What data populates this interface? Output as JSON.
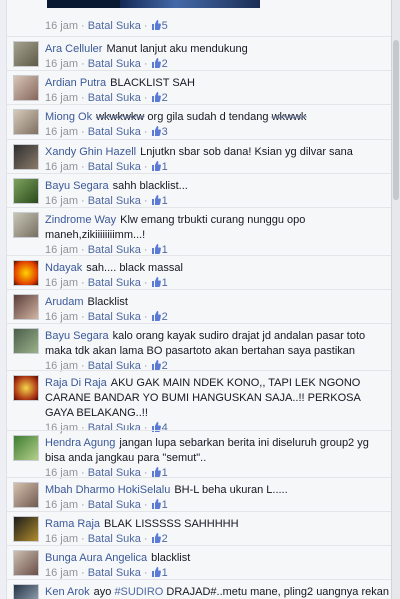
{
  "meta_labels": {
    "time": "16 jam",
    "sep": "·",
    "unlike": "Batal Suka"
  },
  "top_row": {
    "likes": "5"
  },
  "comments": [
    {
      "author": "Ara Celluler",
      "text": "Manut lanjut aku mendukung",
      "likes": "2"
    },
    {
      "author": "Ardian Putra",
      "text": "BLACKLIST SAH",
      "likes": "2"
    },
    {
      "author": "Miong Ok",
      "text_strike": "wkwkwkw",
      "text": " org gila sudah d tendang ",
      "text_strike2": "wkwwk",
      "likes": "3"
    },
    {
      "author": "Xandy Ghin Hazell",
      "text": "Lnjutkn sbar sob dana! Ksian yg dilvar sana",
      "likes": "1"
    },
    {
      "author": "Bayu Segara",
      "text": "sahh blacklist...",
      "likes": "1"
    },
    {
      "author": "Zindrome Way",
      "text": "Klw emang trbukti curang nunggu opo maneh,zikiiiiiiiimm...!",
      "likes": "1"
    },
    {
      "author": "Ndayak",
      "text": "sah.... black massal",
      "likes": "1"
    },
    {
      "author": "Arudam",
      "text": "Blacklist",
      "likes": "2"
    },
    {
      "author": "Bayu Segara",
      "text": "kalo orang kayak sudiro drajat jd andalan pasar toto maka tdk akan lama BO pasartoto akan bertahan saya pastikan",
      "likes": "2"
    },
    {
      "author": "Raja Di Raja",
      "text": "AKU GAK MAIN NDEK KONO,, TAPI LEK NGONO CARANE BANDAR YO BUMI HANGUSKAN SAJA..!! PERKOSA GAYA BELAKANG..!!",
      "likes": "4"
    },
    {
      "author": "Hendra Agung",
      "text": "jangan lupa sebarkan berita ini diseluruh group2 yg bisa anda jangkau para \"semut\"..",
      "likes": "1"
    },
    {
      "author": "Mbah Dharmo HokiSelalu",
      "text": "BH-L beha ukuran L.....",
      "likes": "1"
    },
    {
      "author": "Rama Raja",
      "text": "BLAK LISSSSS SAHHHHH",
      "likes": "2"
    },
    {
      "author": "Bunga Aura Angelica",
      "text": "blacklist",
      "likes": "1"
    },
    {
      "author": "Ken Arok",
      "text_pre": "ayo ",
      "hashtag": "#SUDIRO",
      "text": " DRAJAD#..metu mane, pling2 uangnya rekan",
      "likes": ""
    }
  ],
  "colors": {
    "link": "#3b5998",
    "meta": "#90949c",
    "bg": "#f6f7f9"
  }
}
